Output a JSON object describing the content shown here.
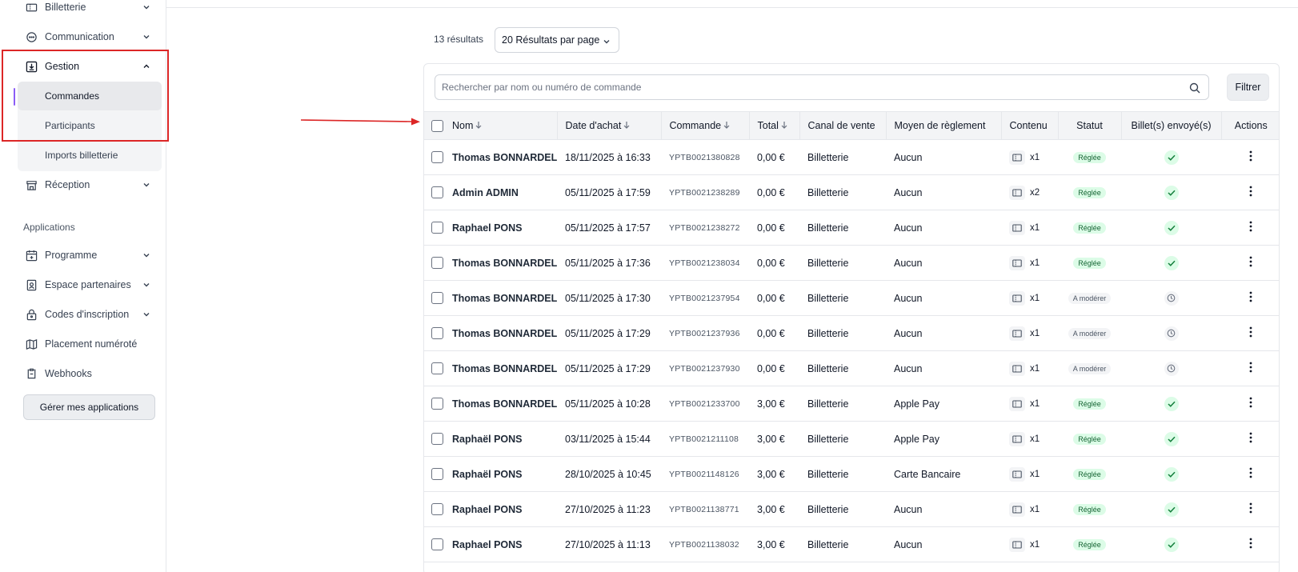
{
  "sidebar": {
    "items": [
      {
        "label": "Billetterie",
        "icon": "ticket-icon"
      },
      {
        "label": "Communication",
        "icon": "chat-bubble-icon"
      },
      {
        "label": "Gestion",
        "icon": "download-box-icon"
      },
      {
        "label": "Réception",
        "icon": "store-icon"
      }
    ],
    "gestion_subitems": [
      {
        "label": "Commandes",
        "active": true
      },
      {
        "label": "Participants"
      },
      {
        "label": "Imports billetterie"
      }
    ],
    "apps_section_label": "Applications",
    "apps": [
      {
        "label": "Programme",
        "icon": "calendar-icon"
      },
      {
        "label": "Espace partenaires",
        "icon": "badge-icon"
      },
      {
        "label": "Codes d'inscription",
        "icon": "lock-icon"
      },
      {
        "label": "Placement numéroté",
        "icon": "map-icon"
      },
      {
        "label": "Webhooks",
        "icon": "webhook-icon"
      }
    ],
    "manage_apps_label": "Gérer mes applications"
  },
  "results": {
    "count_label": "13 résultats",
    "per_page_label": "20 Résultats par page"
  },
  "search": {
    "placeholder": "Rechercher par nom ou numéro de commande",
    "filter_label": "Filtrer"
  },
  "table": {
    "headers": {
      "nom": "Nom",
      "date": "Date d'achat",
      "commande": "Commande",
      "total": "Total",
      "canal": "Canal de vente",
      "moyen": "Moyen de règlement",
      "contenu": "Contenu",
      "statut": "Statut",
      "billets": "Billet(s) envoyé(s)",
      "actions": "Actions"
    },
    "rows": [
      {
        "nom": "Thomas BONNARDEL",
        "date": "18/11/2025 à 16:33",
        "commande": "YPTB0021380828",
        "total": "0,00 €",
        "canal": "Billetterie",
        "moyen": "Aucun",
        "contenu": "x1",
        "statut": "Réglée"
      },
      {
        "nom": "Admin ADMIN",
        "date": "05/11/2025 à 17:59",
        "commande": "YPTB0021238289",
        "total": "0,00 €",
        "canal": "Billetterie",
        "moyen": "Aucun",
        "contenu": "x2",
        "statut": "Réglée"
      },
      {
        "nom": "Raphael PONS",
        "date": "05/11/2025 à 17:57",
        "commande": "YPTB0021238272",
        "total": "0,00 €",
        "canal": "Billetterie",
        "moyen": "Aucun",
        "contenu": "x1",
        "statut": "Réglée"
      },
      {
        "nom": "Thomas BONNARDEL",
        "date": "05/11/2025 à 17:36",
        "commande": "YPTB0021238034",
        "total": "0,00 €",
        "canal": "Billetterie",
        "moyen": "Aucun",
        "contenu": "x1",
        "statut": "Réglée"
      },
      {
        "nom": "Thomas BONNARDEL",
        "date": "05/11/2025 à 17:30",
        "commande": "YPTB0021237954",
        "total": "0,00 €",
        "canal": "Billetterie",
        "moyen": "Aucun",
        "contenu": "x1",
        "statut": "A modérer"
      },
      {
        "nom": "Thomas BONNARDEL",
        "date": "05/11/2025 à 17:29",
        "commande": "YPTB0021237936",
        "total": "0,00 €",
        "canal": "Billetterie",
        "moyen": "Aucun",
        "contenu": "x1",
        "statut": "A modérer"
      },
      {
        "nom": "Thomas BONNARDEL",
        "date": "05/11/2025 à 17:29",
        "commande": "YPTB0021237930",
        "total": "0,00 €",
        "canal": "Billetterie",
        "moyen": "Aucun",
        "contenu": "x1",
        "statut": "A modérer"
      },
      {
        "nom": "Thomas BONNARDEL",
        "date": "05/11/2025 à 10:28",
        "commande": "YPTB0021233700",
        "total": "3,00 €",
        "canal": "Billetterie",
        "moyen": "Apple Pay",
        "contenu": "x1",
        "statut": "Réglée"
      },
      {
        "nom": "Raphaël PONS",
        "date": "03/11/2025 à 15:44",
        "commande": "YPTB0021211108",
        "total": "3,00 €",
        "canal": "Billetterie",
        "moyen": "Apple Pay",
        "contenu": "x1",
        "statut": "Réglée"
      },
      {
        "nom": "Raphaël PONS",
        "date": "28/10/2025 à 10:45",
        "commande": "YPTB0021148126",
        "total": "3,00 €",
        "canal": "Billetterie",
        "moyen": "Carte Bancaire",
        "contenu": "x1",
        "statut": "Réglée"
      },
      {
        "nom": "Raphael PONS",
        "date": "27/10/2025 à 11:23",
        "commande": "YPTB0021138771",
        "total": "3,00 €",
        "canal": "Billetterie",
        "moyen": "Aucun",
        "contenu": "x1",
        "statut": "Réglée"
      },
      {
        "nom": "Raphael PONS",
        "date": "27/10/2025 à 11:13",
        "commande": "YPTB0021138032",
        "total": "3,00 €",
        "canal": "Billetterie",
        "moyen": "Aucun",
        "contenu": "x1",
        "statut": "Réglée"
      }
    ]
  },
  "colors": {
    "accent_bar": "#8b5cf6",
    "annotation_red": "#dc2626",
    "badge_ok_bg": "#dcfce7",
    "badge_ok_text": "#166534"
  }
}
